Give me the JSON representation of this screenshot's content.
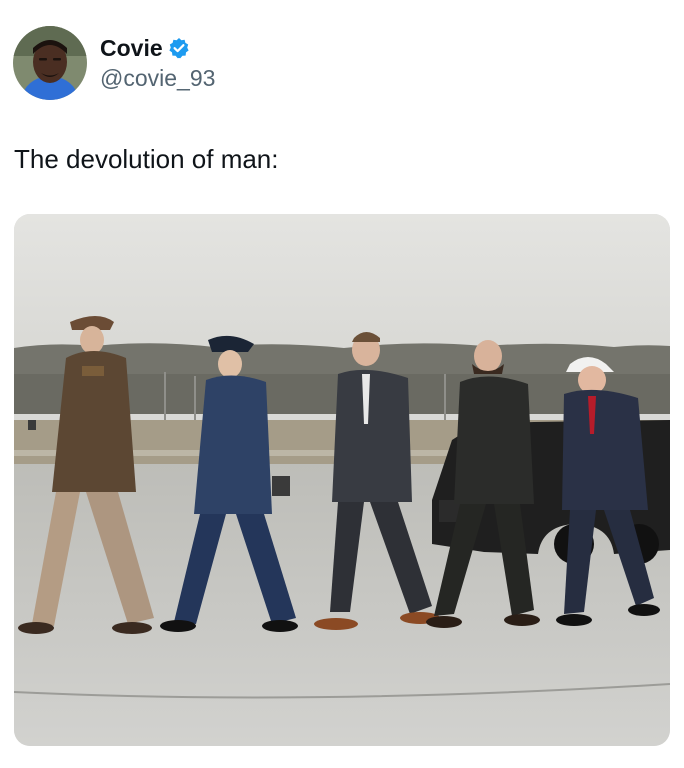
{
  "tweet": {
    "author": {
      "display_name": "Covie",
      "handle": "@covie_93",
      "verified": true,
      "verified_color": "#1d9bf0"
    },
    "text": "The devolution of man:",
    "media": {
      "kind": "photo"
    }
  },
  "icons": {
    "verified": "verified-badge-icon"
  },
  "colors": {
    "text_primary": "#0f1419",
    "text_secondary": "#536471",
    "background": "#ffffff"
  }
}
